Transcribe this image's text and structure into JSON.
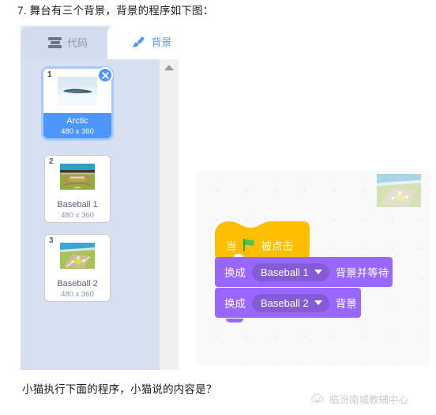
{
  "question": {
    "heading": "7. 舞台有三个背景，背景的程序如下图：",
    "prompt": "小猫执行下面的程序，小猫说的内容是？"
  },
  "editor": {
    "tabs": [
      {
        "label": "代码",
        "icon": "blocks-icon",
        "selected": false
      },
      {
        "label": "背景",
        "icon": "paintbrush-icon",
        "selected": true
      }
    ],
    "backdrops": [
      {
        "index": "1",
        "name": "Arctic",
        "size": "480 x 360",
        "selected": true,
        "delete_icon": "close-icon"
      },
      {
        "index": "2",
        "name": "Baseball 1",
        "size": "480 x 360",
        "selected": false
      },
      {
        "index": "3",
        "name": "Baseball 2",
        "size": "480 x 360",
        "selected": false
      }
    ],
    "scrollbar": {
      "up_arrow_icon": "chevron-up-icon"
    }
  },
  "script": {
    "hat": {
      "prefix": "当",
      "flag_icon": "green-flag-icon",
      "suffix": "被点击"
    },
    "blocks": [
      {
        "prefix": "换成",
        "dropdown_value": "Baseball 1",
        "dropdown_caret_icon": "chevron-down-icon",
        "suffix": "背景并等待"
      },
      {
        "prefix": "换成",
        "dropdown_value": "Baseball 2",
        "dropdown_caret_icon": "chevron-down-icon",
        "suffix": "背景"
      }
    ]
  },
  "watermark": {
    "text": "临汾南城教辅中心",
    "icon": "cloud-face-logo-icon"
  },
  "colors": {
    "events_yellow": "#ffbf00",
    "looks_purple": "#9966ff",
    "looks_purple_dark": "#855cd6",
    "selection_blue": "#4c97ff",
    "panel_blue": "#d7e0f0",
    "tab_active_text": "#5b9ae8"
  }
}
